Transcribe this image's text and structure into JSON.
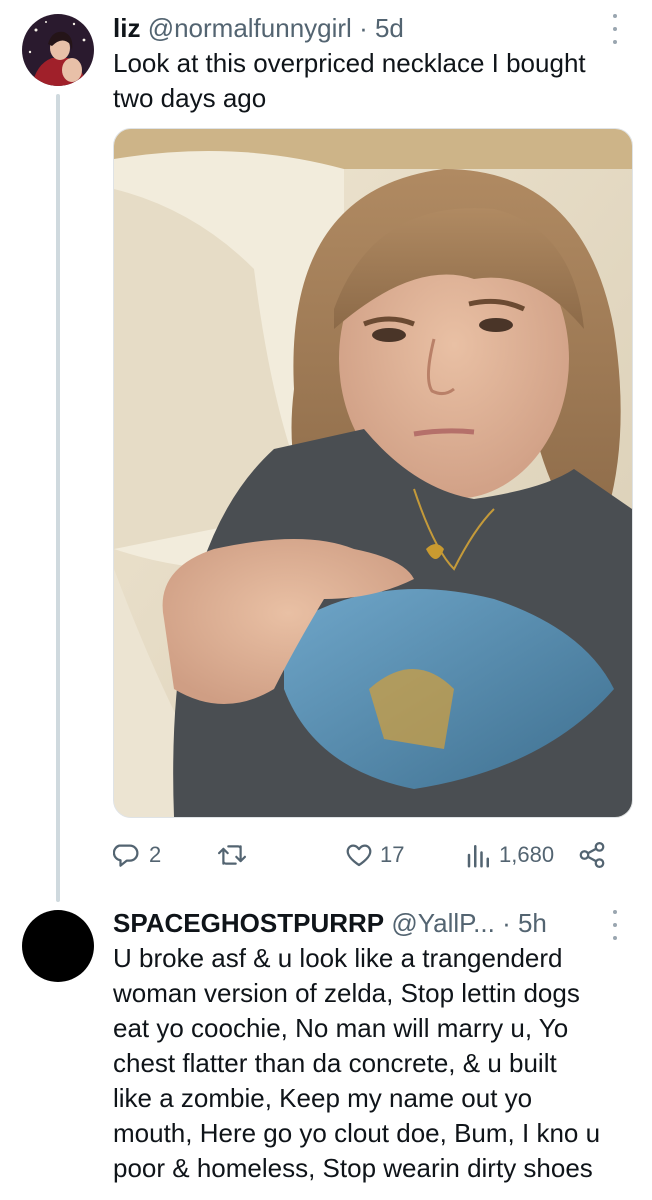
{
  "tweet1": {
    "name": "liz",
    "handle": "@normalfunnygirl",
    "separator": "·",
    "time": "5d",
    "text_lines": [
      "Look at this overpriced necklace I bought",
      "two days ago"
    ],
    "actions": {
      "reply_count": "2",
      "retweet_count": "",
      "like_count": "17",
      "views_count": "1,680"
    }
  },
  "tweet2": {
    "name": "SPACEGHOSTPURRP",
    "handle": "@YallP...",
    "separator": "·",
    "time": "5h",
    "text_lines": [
      "U broke asf & u look like a trangenderd",
      "woman version of zelda, Stop lettin dogs",
      "eat yo coochie, No man will marry u, Yo",
      "chest flatter than da concrete, & u built",
      "like a zombie, Keep my name out yo",
      "mouth, Here go yo clout doe, Bum, I kno u",
      "poor & homeless, Stop wearin dirty shoes"
    ]
  },
  "icons": {
    "reply": "reply-icon",
    "retweet": "retweet-icon",
    "like": "heart-icon",
    "views": "views-icon",
    "share": "share-icon",
    "more": "more-icon"
  },
  "colors": {
    "text": "#0f1419",
    "secondary": "#536471",
    "thread_line": "#cfd9de"
  }
}
